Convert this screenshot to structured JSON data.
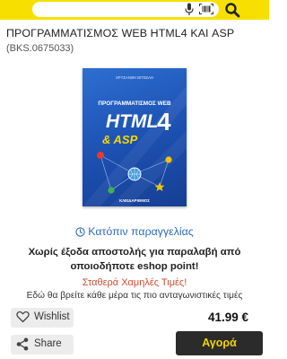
{
  "header": {
    "search_placeholder": "",
    "icons": [
      "mic-icon",
      "barcode-icon",
      "search-icon"
    ],
    "accent_color": "#f7e000"
  },
  "product": {
    "title": "ΠΡΟΓΡΑΜΜΑΤΙΣΜΟΣ WEB HTML4 ΚΑΙ ASP",
    "code": "(BKS.0675033)",
    "cover": {
      "author": "ΧΡΥΣΑΝΘΗ ΒΙΤΣΕΛΗ",
      "heading": "ΠΡΟΓΡΑΜΜΑΤΙΣΜΟΣ WEB",
      "html": "HTML",
      "four": "4",
      "asp": "& ASP",
      "publisher": "ΚΛΕΙΔΑΡΙΘΜΟΣ"
    }
  },
  "availability": {
    "order_label": "Κατόπιν παραγγελίας",
    "shipping_text": "Χωρίς έξοδα αποστολής για παραλαβή από οποιοδήποτε eshop point!",
    "price_note": "Σταθερά Χαμηλές Τιμές!",
    "price_desc": "Εδώ θα βρείτε κάθε μέρα τις πιο ανταγωνιστικές τιμές"
  },
  "actions": {
    "wishlist_label": "Wishlist",
    "share_label": "Share",
    "price": "41.99 €",
    "buy_label": "Αγορά",
    "buy_text_color": "#f2d400"
  }
}
